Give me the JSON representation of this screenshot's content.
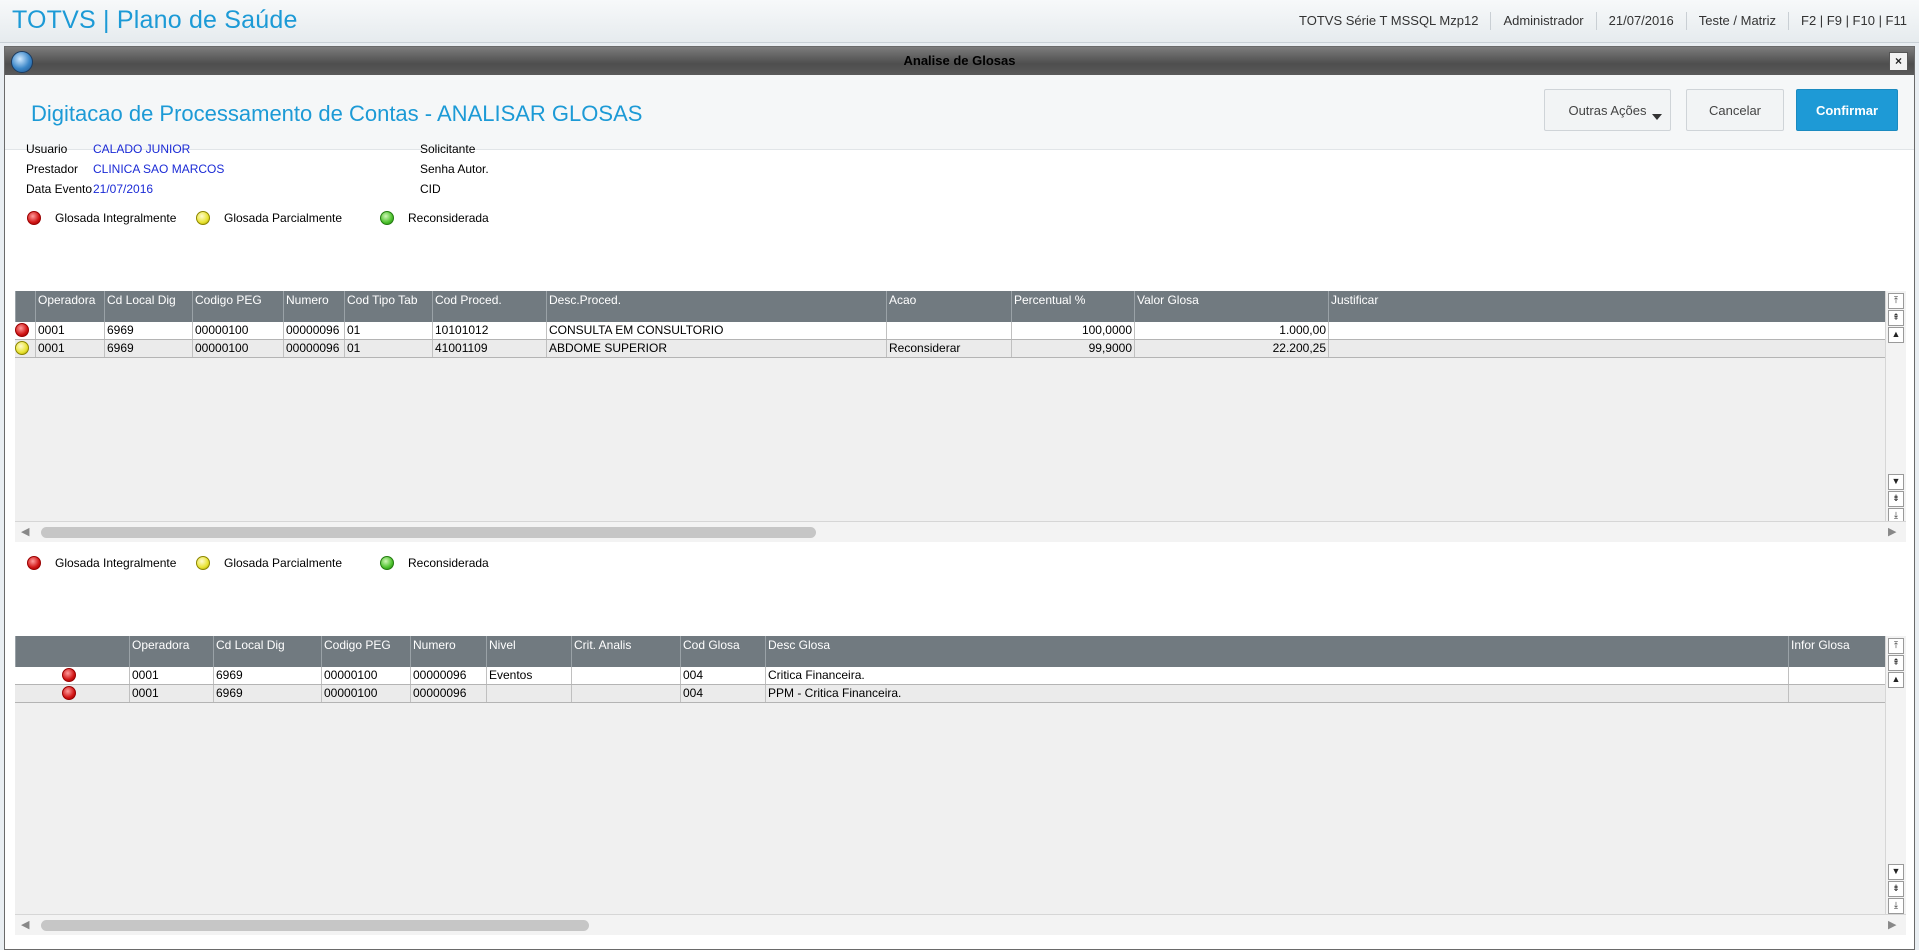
{
  "app": {
    "title": "TOTVS | Plano de Saúde",
    "info": [
      "TOTVS Série T  MSSQL Mzp12",
      "Administrador",
      "21/07/2016",
      "Teste / Matriz",
      "F2 | F9 | F10 | F11"
    ]
  },
  "dialog": {
    "title": "Analise de Glosas",
    "close_label": "×",
    "page_title": "Digitacao de Processamento de Contas - ANALISAR GLOSAS",
    "buttons": {
      "other_actions": "Outras Ações",
      "cancel": "Cancelar",
      "confirm": "Confirmar"
    }
  },
  "info": {
    "usuario_label": "Usuario",
    "usuario_value": "CALADO JUNIOR",
    "prestador_label": "Prestador",
    "prestador_value": "CLINICA SAO MARCOS",
    "data_evento_label": "Data Evento",
    "data_evento_value": "21/07/2016",
    "solicitante_label": "Solicitante",
    "senha_label": "Senha Autor.",
    "cid_label": "CID"
  },
  "legend": {
    "red": "Glosada Integralmente",
    "yellow": "Glosada Parcialmente",
    "green": "Reconsiderada"
  },
  "colors": {
    "accent": "#1e9ad6",
    "header_bg": "#717a80",
    "link_value": "#1b2bd6"
  },
  "grid1": {
    "headers": [
      "",
      "Operadora",
      "Cd Local Dig",
      "Codigo PEG",
      "Numero",
      "Cod Tipo Tab",
      "Cod Proced.",
      "Desc.Proced.",
      "Acao",
      "Percentual %",
      "Valor Glosa",
      "Justificar"
    ],
    "rows": [
      {
        "status": "red",
        "operadora": "0001",
        "cd_local_dig": "6969",
        "codigo_peg": "00000100",
        "numero": "00000096",
        "cod_tipo_tab": "01",
        "cod_proced": "10101012",
        "desc_proced": "CONSULTA EM CONSULTORIO",
        "acao": "",
        "percentual": "100,0000",
        "valor_glosa": "1.000,00",
        "justificar": ""
      },
      {
        "status": "yellow",
        "operadora": "0001",
        "cd_local_dig": "6969",
        "codigo_peg": "00000100",
        "numero": "00000096",
        "cod_tipo_tab": "01",
        "cod_proced": "41001109",
        "desc_proced": "ABDOME SUPERIOR",
        "acao": "Reconsiderar",
        "percentual": "99,9000",
        "valor_glosa": "22.200,25",
        "justificar": ""
      }
    ]
  },
  "grid2": {
    "headers": [
      "",
      "Operadora",
      "Cd Local Dig",
      "Codigo PEG",
      "Numero",
      "Nivel",
      "Crit. Analis",
      "Cod Glosa",
      "Desc Glosa",
      "Infor Glosa"
    ],
    "rows": [
      {
        "status": "red",
        "operadora": "0001",
        "cd_local_dig": "6969",
        "codigo_peg": "00000100",
        "numero": "00000096",
        "nivel": "Eventos",
        "crit_analis": "",
        "cod_glosa": "004",
        "desc_glosa": "Critica Financeira.",
        "infor_glosa": ""
      },
      {
        "status": "red",
        "operadora": "0001",
        "cd_local_dig": "6969",
        "codigo_peg": "00000100",
        "numero": "00000096",
        "nivel": "",
        "crit_analis": "",
        "cod_glosa": "004",
        "desc_glosa": "PPM - Critica Financeira.",
        "infor_glosa": ""
      }
    ]
  },
  "scroll": {
    "top": "⤒",
    "pageup": "⇞",
    "up": "▲",
    "down": "▼",
    "pagedown": "⇟",
    "bottom": "⤓",
    "left": "◀",
    "right": "▶"
  }
}
